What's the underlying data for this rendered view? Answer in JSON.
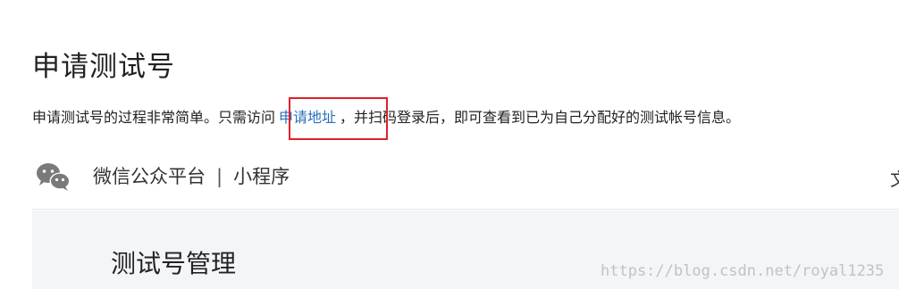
{
  "page": {
    "title": "申请测试号",
    "description_before": "申请测试号的过程非常简单。只需访问",
    "apply_link_label": "申请地址",
    "description_after": "，并扫码登录后，即可查看到已为自己分配好的测试帐号信息。"
  },
  "brand_header": {
    "logo_icon": "wechat-bubbles-icon",
    "platform_name": "微信公众平台",
    "separator": "|",
    "section_name": "小程序",
    "edge_text": "文"
  },
  "panel": {
    "title": "测试号管理"
  },
  "watermark": {
    "text": "https://blog.csdn.net/royal1235"
  },
  "colors": {
    "link": "#2a6ebb",
    "highlight_border": "#e0202a",
    "panel_bg": "#f4f5f9",
    "logo": "#7a7a7a"
  }
}
